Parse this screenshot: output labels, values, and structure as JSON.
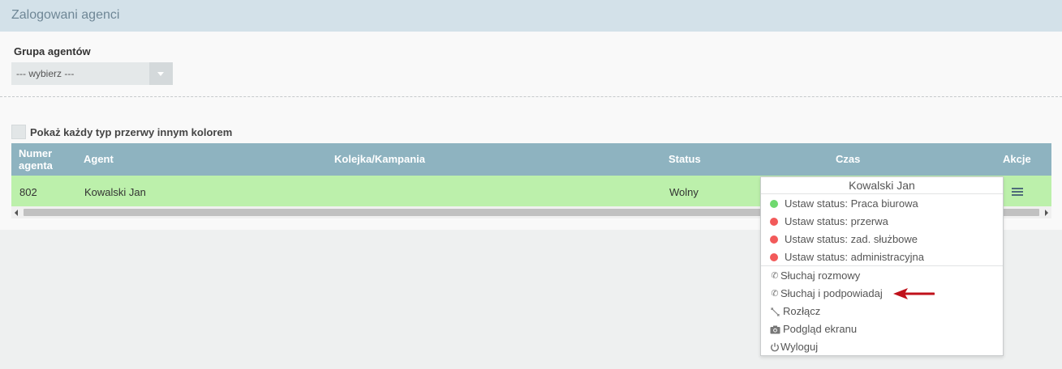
{
  "header": {
    "title": "Zalogowani agenci"
  },
  "filter": {
    "group_label": "Grupa agentów",
    "group_select_value": "--- wybierz ---"
  },
  "options": {
    "color_breaks_label": "Pokaż każdy typ przerwy innym kolorem"
  },
  "table": {
    "columns": {
      "number_line1": "Numer",
      "number_line2": "agenta",
      "agent": "Agent",
      "queue": "Kolejka/Kampania",
      "status": "Status",
      "time": "Czas",
      "actions": "Akcje"
    },
    "rows": [
      {
        "number": "802",
        "agent": "Kowalski Jan",
        "queue": "",
        "status": "Wolny",
        "time": ""
      }
    ]
  },
  "context_menu": {
    "title": "Kowalski Jan",
    "status_items": [
      {
        "label": "Ustaw status: Praca biurowa",
        "color": "#6fd96f"
      },
      {
        "label": "Ustaw status: przerwa",
        "color": "#f25a5a"
      },
      {
        "label": "Ustaw status: zad. służbowe",
        "color": "#f25a5a"
      },
      {
        "label": "Ustaw status: administracyjna",
        "color": "#f25a5a"
      }
    ],
    "actions": {
      "listen": "Słuchaj rozmowy",
      "whisper": "Słuchaj i podpowiadaj",
      "disconnect": "Rozłącz",
      "screen": "Podgląd ekranu",
      "logout": "Wyloguj"
    }
  },
  "colors": {
    "header_bg": "#d3e1e9",
    "table_header_bg": "#8eb3c0",
    "row_available_bg": "#bcf0ab",
    "annotation_arrow": "#c0111a"
  }
}
